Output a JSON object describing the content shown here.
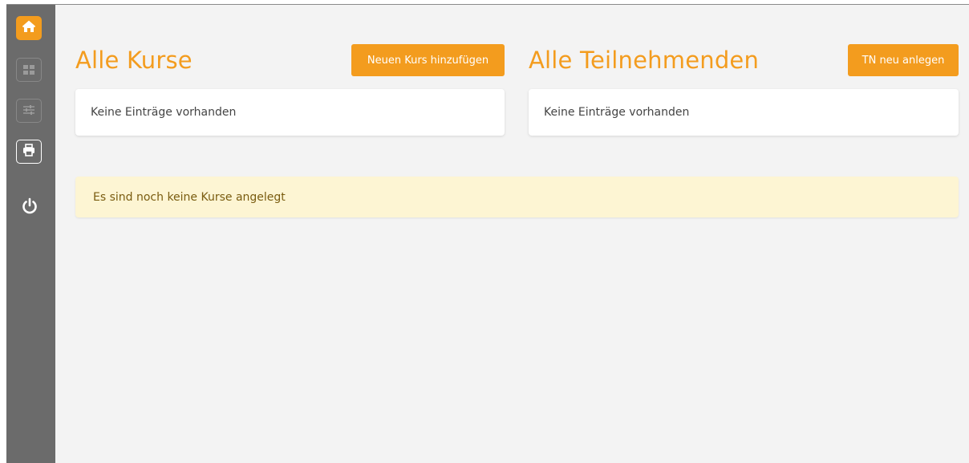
{
  "sidebar": {
    "items": [
      {
        "icon": "home-icon",
        "active": true
      },
      {
        "icon": "dashboard-grid-icon",
        "active": false
      },
      {
        "icon": "sliders-icon",
        "active": false
      },
      {
        "icon": "print-icon",
        "active": false
      },
      {
        "icon": "power-icon",
        "active": false
      }
    ]
  },
  "courses": {
    "title": "Alle Kurse",
    "add_button": "Neuen Kurs hinzufügen",
    "empty_text": "Keine Einträge vorhanden"
  },
  "participants": {
    "title": "Alle Teilnehmenden",
    "add_button": "TN neu anlegen",
    "empty_text": "Keine Einträge vorhanden"
  },
  "alert": {
    "text": "Es sind noch keine Kurse angelegt"
  },
  "colors": {
    "accent": "#f39c1e",
    "sidebar": "#6b6b6b",
    "background": "#f3f3f3",
    "alert_bg": "#fdf5d3"
  }
}
